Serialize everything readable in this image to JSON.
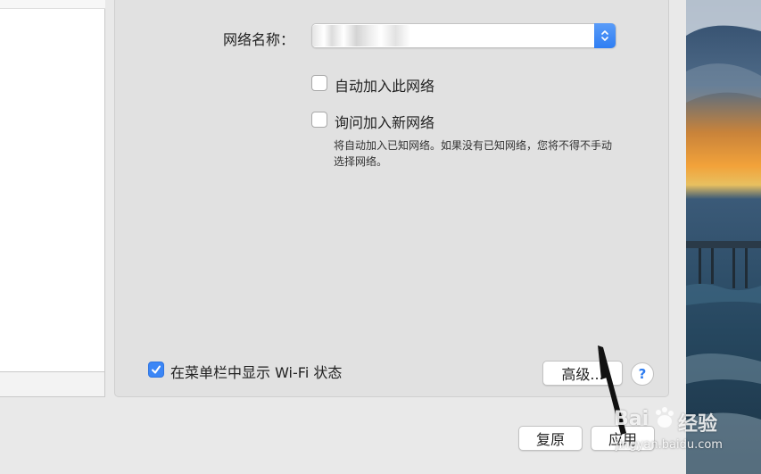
{
  "network": {
    "label": "网络名称：",
    "value": ""
  },
  "options": {
    "auto_join_label": "自动加入此网络",
    "auto_join_checked": false,
    "ask_join_label": "询问加入新网络",
    "ask_join_checked": false,
    "ask_join_hint": "将自动加入已知网络。如果没有已知网络，您将不得不手动选择网络。"
  },
  "menubar": {
    "show_wifi_label": "在菜单栏中显示 Wi-Fi 状态",
    "show_wifi_checked": true
  },
  "buttons": {
    "advanced": "高级...",
    "help": "?",
    "revert": "复原",
    "apply": "应用"
  },
  "watermark": {
    "brand_left": "Bai",
    "brand_right": "经验",
    "url": "jingyan.baidu.com"
  },
  "colors": {
    "accent": "#3b86f6",
    "panel": "#e1e1e1"
  }
}
